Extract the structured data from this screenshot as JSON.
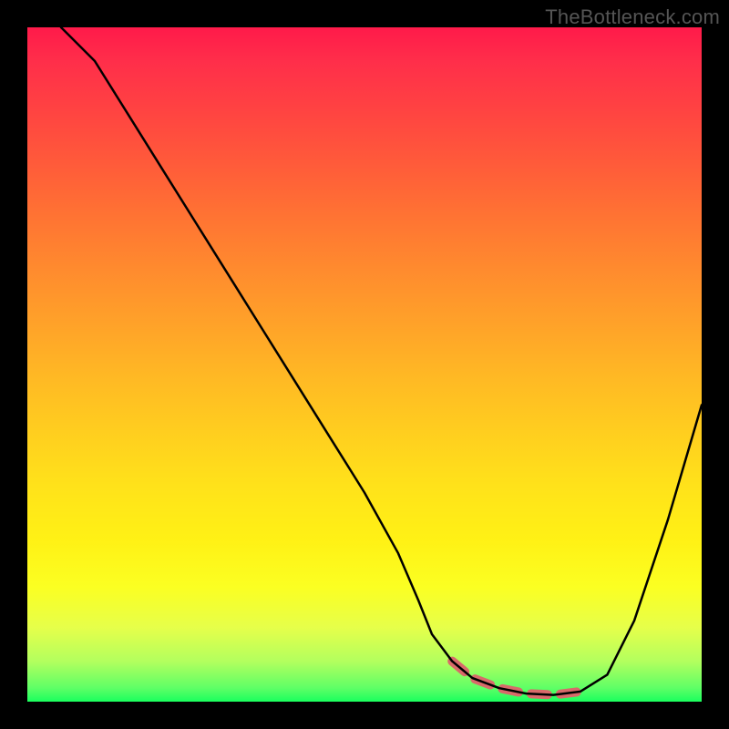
{
  "watermark": "TheBottleneck.com",
  "chart_data": {
    "type": "line",
    "title": "",
    "xlabel": "",
    "ylabel": "",
    "xlim": [
      0,
      100
    ],
    "ylim": [
      0,
      100
    ],
    "x": [
      5,
      10,
      15,
      20,
      25,
      30,
      35,
      40,
      45,
      50,
      55,
      58,
      60,
      63,
      66,
      70,
      74,
      78,
      82,
      86,
      90,
      95,
      100
    ],
    "values": [
      100,
      95,
      87,
      79,
      71,
      63,
      55,
      47,
      39,
      31,
      22,
      15,
      10,
      6,
      3.5,
      2,
      1.2,
      1,
      1.5,
      4,
      12,
      27,
      44
    ],
    "highlight_x_range": [
      62,
      84
    ],
    "annotations": [],
    "gradient_top_color": "#ff1a4a",
    "gradient_bottom_color": "#1aff5e",
    "curve_color": "#000000",
    "highlight_color": "#d86a6a"
  }
}
